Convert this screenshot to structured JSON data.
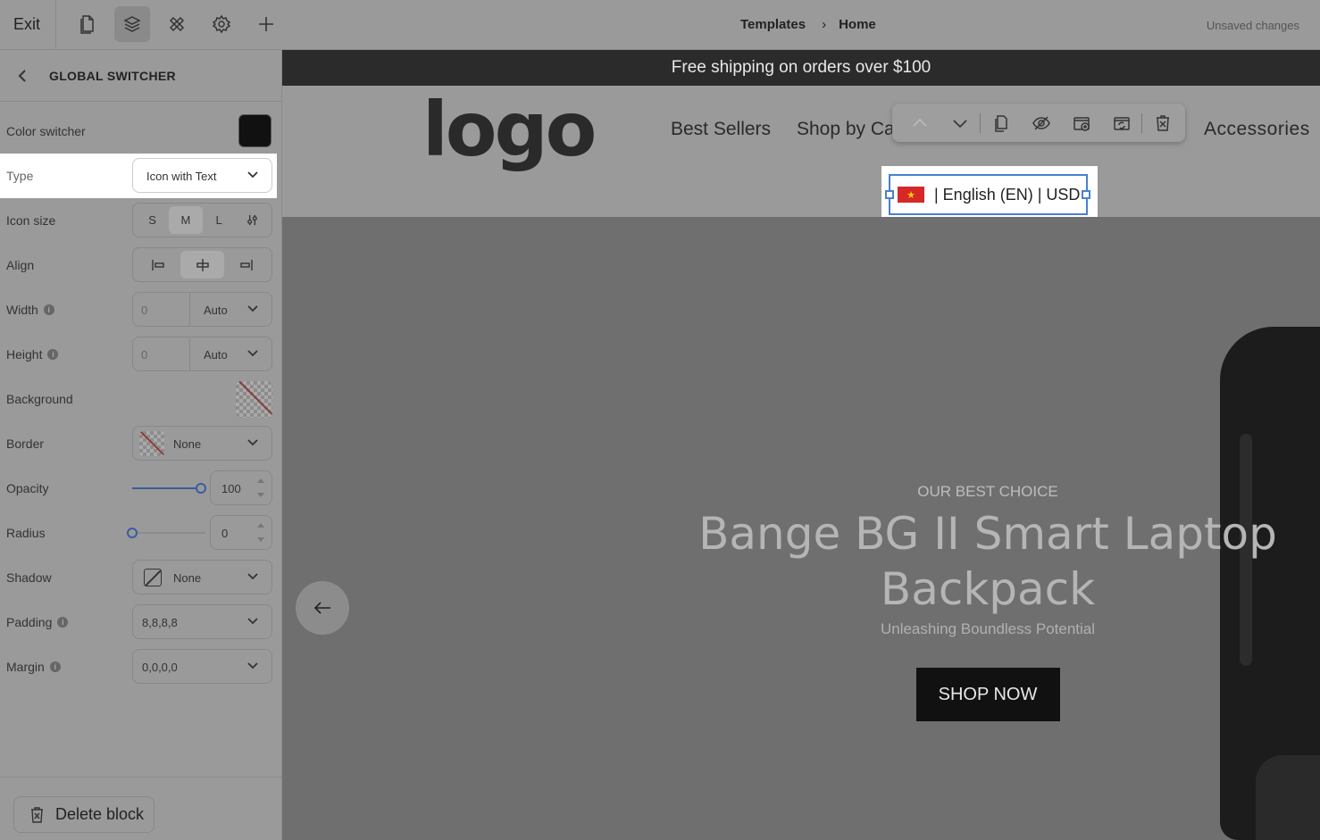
{
  "topbar": {
    "exit_label": "Exit",
    "icons": [
      "page-icon",
      "layers-icon",
      "components-icon",
      "settings-icon",
      "add-icon"
    ],
    "breadcrumb": [
      "Templates",
      "Home"
    ],
    "status": "Unsaved changes"
  },
  "panel": {
    "title": "GLOBAL SWITCHER",
    "color_label": "Color switcher",
    "color_value": "#111111",
    "type_label": "Type",
    "type_value": "Icon with Text",
    "icon_size_label": "Icon size",
    "icon_sizes": [
      "S",
      "M",
      "L"
    ],
    "icon_size_selected": "M",
    "align_label": "Align",
    "width_label": "Width",
    "width_value": "0",
    "width_unit": "Auto",
    "height_label": "Height",
    "height_value": "0",
    "height_unit": "Auto",
    "background_label": "Background",
    "border_label": "Border",
    "border_value": "None",
    "opacity_label": "Opacity",
    "opacity_value": "100",
    "radius_label": "Radius",
    "radius_value": "0",
    "shadow_label": "Shadow",
    "shadow_value": "None",
    "padding_label": "Padding",
    "padding_value": "8,8,8,8",
    "margin_label": "Margin",
    "margin_value": "0,0,0,0",
    "delete_label": "Delete block"
  },
  "canvas": {
    "announcement": "Free shipping on orders over $100",
    "logo": "logo",
    "nav": [
      "Best Sellers",
      "Shop by Ca",
      "Accessories"
    ],
    "switcher_text": "| English (EN) | USD",
    "hero": {
      "kicker": "OUR BEST CHOICE",
      "title_line1": "Bange BG II Smart Laptop",
      "title_line2": "Backpack",
      "tagline": "Unleashing Boundless Potential",
      "cta": "SHOP NOW"
    }
  },
  "colors": {
    "accent": "#4a80d0",
    "slider": "#3a5da0"
  }
}
